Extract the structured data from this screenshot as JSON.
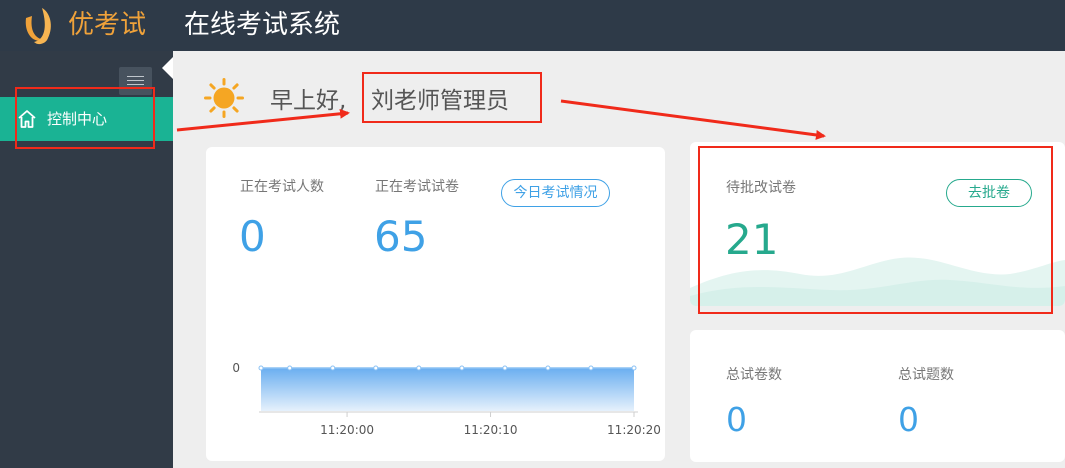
{
  "header": {
    "logo_text": "优考试",
    "title": "在线考试系统",
    "logo_icon": "logo-icon",
    "colors": {
      "bar": "#2e3a48",
      "logo": "#f0a23a"
    }
  },
  "sidebar": {
    "toggle_icon": "hamburger-icon",
    "items": [
      {
        "label": "控制中心",
        "icon": "home-icon",
        "active": true
      }
    ],
    "colors": {
      "background": "#313b47",
      "active": "#1ab394"
    }
  },
  "greeting": {
    "icon": "sun-icon",
    "text": "早上好,",
    "name": "刘老师管理员"
  },
  "exam_card": {
    "examinees_label": "正在考试人数",
    "examinees_value": "0",
    "papers_label": "正在考试试卷",
    "papers_value": "65",
    "button_label": "今日考试情况"
  },
  "review_card": {
    "label": "待批改试卷",
    "value": "21",
    "button_label": "去批卷"
  },
  "totals_card": {
    "papers_label": "总试卷数",
    "papers_value": "0",
    "questions_label": "总试题数",
    "questions_value": "0"
  },
  "chart_data": {
    "type": "area",
    "x": [
      "11:20:00",
      "11:20:10",
      "11:20:20"
    ],
    "y_tick_labels": [
      "0"
    ],
    "series": [
      {
        "x": [
          "11:19:54",
          "11:19:56",
          "11:19:59",
          "11:20:02",
          "11:20:05",
          "11:20:08",
          "11:20:11",
          "11:20:14",
          "11:20:17",
          "11:20:20"
        ],
        "values": [
          0,
          0,
          0,
          0,
          0,
          0,
          0,
          0,
          0,
          0
        ]
      }
    ],
    "colors": {
      "fill_top": "#6aaef0",
      "fill_bottom": "#e6f1fc",
      "line": "#8cc2f4"
    }
  },
  "annotations": {
    "color": "#f02a1a"
  }
}
